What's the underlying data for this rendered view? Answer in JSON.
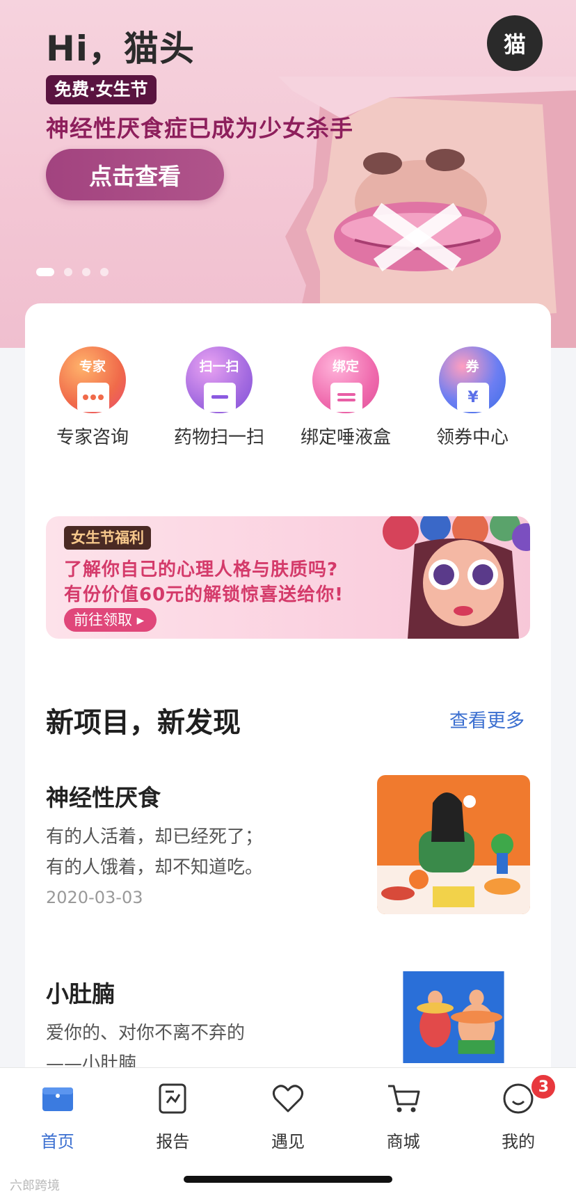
{
  "hero": {
    "greeting": "Hi，猫头",
    "avatar_text": "猫",
    "tag": "免费·女生节",
    "headline": "神经性厌食症已成为少女杀手",
    "cta": "点击查看",
    "carousel_pages": 4,
    "carousel_active": 1
  },
  "quick_actions": [
    {
      "badge": "专家",
      "label": "专家咨询",
      "icon": "chat-bubble-icon"
    },
    {
      "badge": "扫一扫",
      "label": "药物扫一扫",
      "icon": "scan-icon"
    },
    {
      "badge": "绑定",
      "label": "绑定唾液盒",
      "icon": "box-icon"
    },
    {
      "badge": "券",
      "label": "领券中心",
      "icon": "coupon-icon"
    }
  ],
  "promo": {
    "tag": "女生节福利",
    "line1": "了解你自己的心理人格与肤质吗?",
    "line2": "有份价值60元的解锁惊喜送给你!",
    "button": "前往领取 ▸"
  },
  "section": {
    "title": "新项目，新发现",
    "more": "查看更多"
  },
  "articles": [
    {
      "title": "神经性厌食",
      "line1": "有的人活着，却已经死了；",
      "line2": "有的人饿着，却不知道吃。",
      "date": "2020-03-03"
    },
    {
      "title": "小肚腩",
      "line1": "爱你的、对你不离不弃的",
      "line2": "——小肚腩",
      "date": ""
    }
  ],
  "tabbar": {
    "tabs": [
      {
        "label": "首页",
        "icon": "home-box-icon",
        "active": true
      },
      {
        "label": "报告",
        "icon": "report-icon",
        "active": false
      },
      {
        "label": "遇见",
        "icon": "heart-icon",
        "active": false
      },
      {
        "label": "商城",
        "icon": "cart-icon",
        "active": false
      },
      {
        "label": "我的",
        "icon": "profile-icon",
        "active": false
      }
    ],
    "badge_count": "3"
  },
  "watermark": "六郎跨境",
  "colors": {
    "accent": "#3b6fd0",
    "hero_cta": "#a2437f",
    "headline": "#8d1f5c",
    "promo_text": "#d43a6a",
    "badge": "#e8383d"
  }
}
